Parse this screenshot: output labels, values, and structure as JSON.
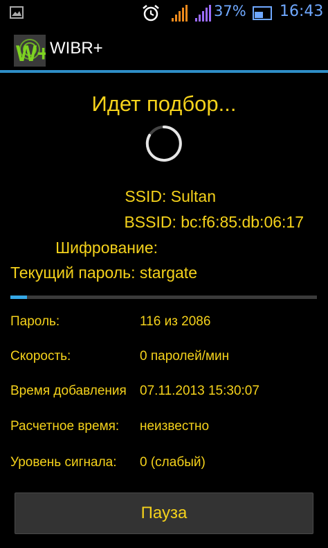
{
  "status_bar": {
    "battery_percent": "37%",
    "time": "16:43",
    "icons": [
      "image-icon",
      "alarm-icon",
      "signal-icon",
      "signal-icon",
      "cast-icon"
    ]
  },
  "app": {
    "title": "WIBR+",
    "logo_letters": "W+",
    "accent_color": "#2e8ec7"
  },
  "main": {
    "status_title": "Идет подбор...",
    "ssid_line": "SSID: Sultan",
    "bssid_line": "BSSID: bc:f6:85:db:06:17",
    "encryption_line": "Шифрование:",
    "current_password_line": "Текущий пароль: stargate",
    "progress_fraction": 0.055,
    "text_color": "#f5d21b"
  },
  "stats": [
    {
      "label": "Пароль:",
      "value": "116 из 2086"
    },
    {
      "label": "Скорость:",
      "value": "0 паролей/мин"
    },
    {
      "label": "Время добавления",
      "value": "07.11.2013 15:30:07"
    },
    {
      "label": "Расчетное время:",
      "value": "неизвестно"
    },
    {
      "label": "Уровень сигнала:",
      "value": "0 (слабый)"
    }
  ],
  "pause_button": {
    "label": "Пауза"
  }
}
